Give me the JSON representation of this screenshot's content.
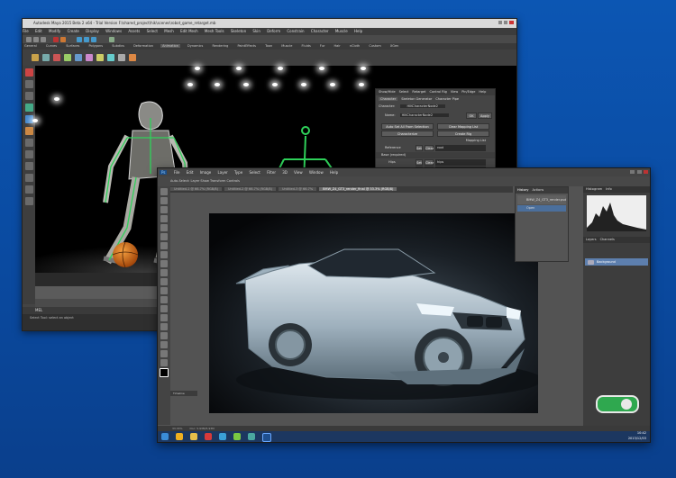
{
  "maya": {
    "title": "Autodesk Maya 2015 Beta 2 x64 - Trial Version  F:\\shared_project\\hik\\scenes\\robot_game_retarget.mb",
    "menu": [
      "File",
      "Edit",
      "Modify",
      "Create",
      "Display",
      "Windows",
      "Assets",
      "Select",
      "Mesh",
      "Edit Mesh",
      "Mesh Tools",
      "Skeleton",
      "Skin",
      "Deform",
      "Constrain",
      "Character",
      "Muscle",
      "Help"
    ],
    "shelf_tabs": [
      "General",
      "Curves",
      "Surfaces",
      "Polygons",
      "Subdivs",
      "Deformation",
      "Animation",
      "Dynamics",
      "Rendering",
      "PaintEffects",
      "Toon",
      "Muscle",
      "Fluids",
      "Fur",
      "Hair",
      "nCloth",
      "Custom",
      "XGen"
    ],
    "active_shelf_tab": "Animation",
    "cmd_label": "MEL",
    "help_line": "Select Tool: select an object"
  },
  "hik": {
    "menu": [
      "Show/Hide",
      "Select",
      "Retarget",
      "Control Rig",
      "View",
      "Pin/Edge",
      "Help"
    ],
    "tabs": [
      "Character",
      "Skeleton Generator",
      "Character Pipe"
    ],
    "character_label": "Character:",
    "character_value": "HIKCharacterNode2",
    "name_label": "Name:",
    "name_value": "HIKCharacterNode2",
    "ok_label": "OK",
    "apply_label": "Apply",
    "btn_auto": "Auto Set All From Selection",
    "btn_clear": "Clear Mapping List",
    "btn_char": "Characterize",
    "btn_rig": "Create Rig",
    "mapping_title": "Mapping List",
    "ref_label": "Reference",
    "set_label": "Set",
    "clear_label": "Clear",
    "ref_value": "root",
    "base_label": "Base (required)",
    "hips_label": "Hips",
    "hips_value": "hips",
    "leftupleg_label": "LeftUpLeg",
    "leftupleg_value": "Lufhip"
  },
  "ps": {
    "menu": [
      "Ps",
      "File",
      "Edit",
      "Image",
      "Layer",
      "Type",
      "Select",
      "Filter",
      "3D",
      "View",
      "Window",
      "Help"
    ],
    "options": "Auto-Select:   Layer     Show Transform Controls",
    "doc_tabs": [
      "Untitled-1 @ 66.7% (RGB/8)",
      "Untitled-2 @ 66.7% (RGB/8)",
      "Untitled-3 @ 66.7%",
      "BMW_Z4_GT3_render_final @ 33.3% (RGB/8)"
    ],
    "active_doc": 3,
    "history_tabs": [
      "History",
      "Actions"
    ],
    "history_items": [
      "BMW_Z4_GT3_render.psd",
      "Open"
    ],
    "histogram_tabs": [
      "Histogram",
      "Info"
    ],
    "layers_tabs": [
      "Layers",
      "Channels"
    ],
    "layer_name": "Background",
    "status_zoom": "33.33%",
    "status_doc": "Doc: 5.93M/5.93M",
    "timeline_label": "Timeline",
    "clock_time": "10:42",
    "clock_date": "2013/12/03"
  },
  "colors": {
    "desktop": "#0a4fa8",
    "maya_bg": "#444444",
    "ps_bg": "#535353",
    "skeleton_green": "#2fd15a",
    "ball_orange": "#e07a18",
    "car_body": "#a8b8c4"
  }
}
